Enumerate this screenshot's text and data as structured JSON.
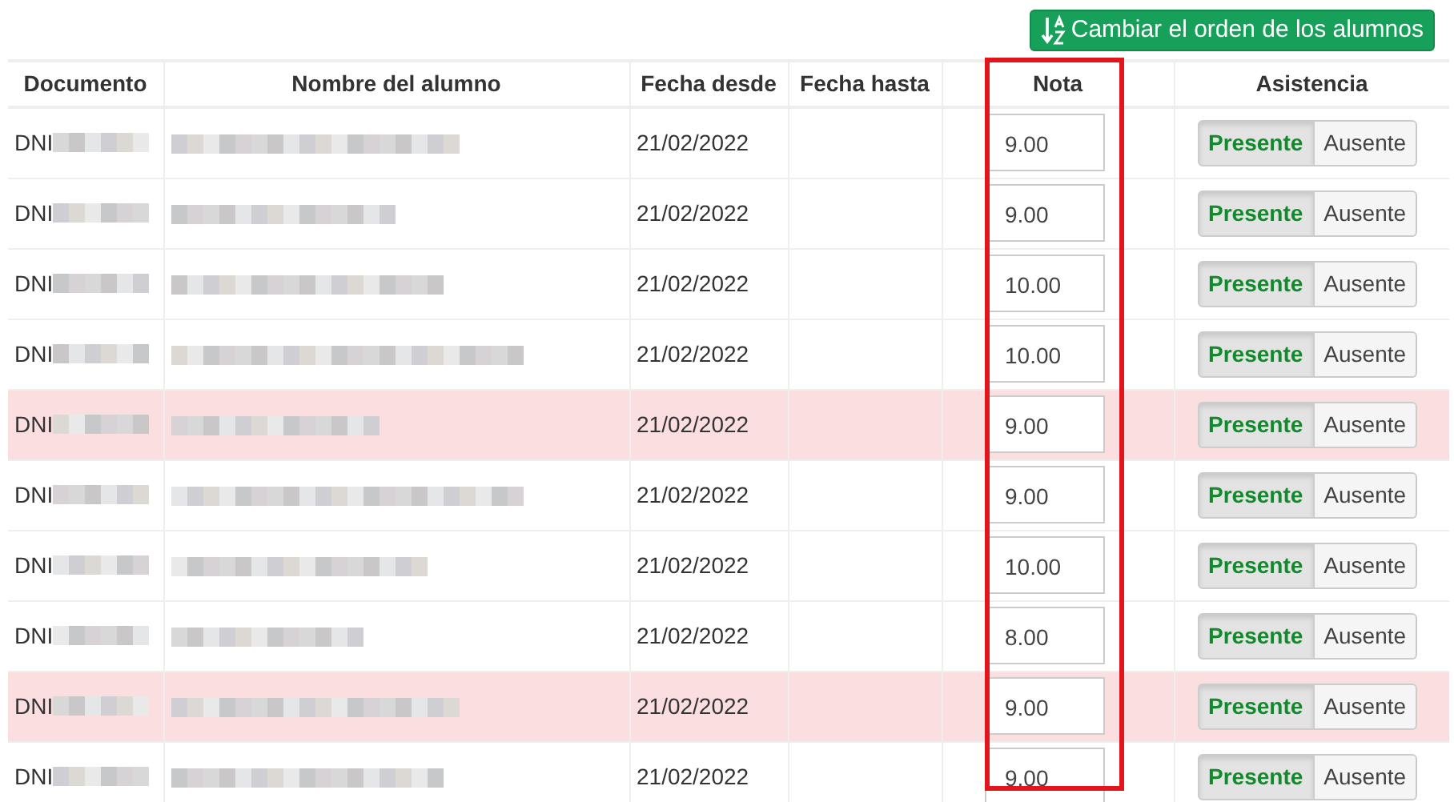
{
  "sort_button": {
    "label": "Cambiar el orden de los alumnos"
  },
  "table": {
    "columns": [
      {
        "label": "Documento",
        "highlighted": false
      },
      {
        "label": "Nombre del alumno",
        "highlighted": false
      },
      {
        "label": "Fecha desde",
        "highlighted": false
      },
      {
        "label": "Fecha hasta",
        "highlighted": false
      },
      {
        "label": "Nota",
        "highlighted": true
      },
      {
        "label": "Asistencia",
        "highlighted": false
      }
    ],
    "rows": [
      {
        "document": "DNI",
        "date_from": "21/02/2022",
        "grade": "9.00",
        "flagged": false,
        "attendance": [
          {
            "label": "Presente",
            "selected": true
          },
          {
            "label": "Ausente",
            "selected": false
          }
        ]
      },
      {
        "document": "DNI",
        "date_from": "21/02/2022",
        "grade": "9.00",
        "flagged": false,
        "attendance": [
          {
            "label": "Presente",
            "selected": true
          },
          {
            "label": "Ausente",
            "selected": false
          }
        ]
      },
      {
        "document": "DNI",
        "date_from": "21/02/2022",
        "grade": "10.00",
        "flagged": false,
        "attendance": [
          {
            "label": "Presente",
            "selected": true
          },
          {
            "label": "Ausente",
            "selected": false
          }
        ]
      },
      {
        "document": "DNI",
        "date_from": "21/02/2022",
        "grade": "10.00",
        "flagged": false,
        "attendance": [
          {
            "label": "Presente",
            "selected": true
          },
          {
            "label": "Ausente",
            "selected": false
          }
        ]
      },
      {
        "document": "DNI",
        "date_from": "21/02/2022",
        "grade": "9.00",
        "flagged": true,
        "attendance": [
          {
            "label": "Presente",
            "selected": true
          },
          {
            "label": "Ausente",
            "selected": false
          }
        ]
      },
      {
        "document": "DNI",
        "date_from": "21/02/2022",
        "grade": "9.00",
        "flagged": false,
        "attendance": [
          {
            "label": "Presente",
            "selected": true
          },
          {
            "label": "Ausente",
            "selected": false
          }
        ]
      },
      {
        "document": "DNI",
        "date_from": "21/02/2022",
        "grade": "10.00",
        "flagged": false,
        "attendance": [
          {
            "label": "Presente",
            "selected": true
          },
          {
            "label": "Ausente",
            "selected": false
          }
        ]
      },
      {
        "document": "DNI",
        "date_from": "21/02/2022",
        "grade": "8.00",
        "flagged": false,
        "attendance": [
          {
            "label": "Presente",
            "selected": true
          },
          {
            "label": "Ausente",
            "selected": false
          }
        ]
      },
      {
        "document": "DNI",
        "date_from": "21/02/2022",
        "grade": "9.00",
        "flagged": true,
        "attendance": [
          {
            "label": "Presente",
            "selected": true
          },
          {
            "label": "Ausente",
            "selected": false
          }
        ]
      },
      {
        "document": "DNI",
        "date_from": "21/02/2022",
        "grade": "9.00",
        "flagged": false,
        "attendance": [
          {
            "label": "Presente",
            "selected": true
          },
          {
            "label": "Ausente",
            "selected": false
          }
        ]
      }
    ]
  }
}
